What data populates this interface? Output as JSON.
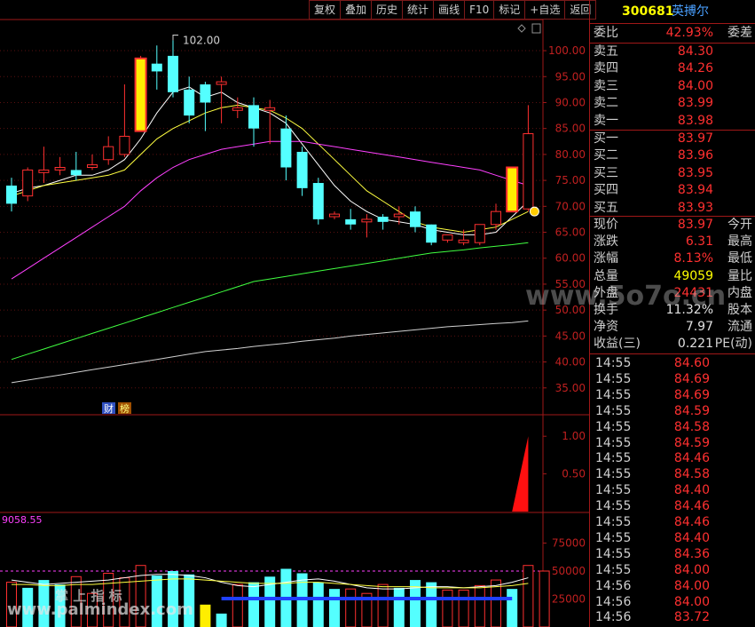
{
  "toolbar": [
    "复权",
    "叠加",
    "历史",
    "统计",
    "画线",
    "F10",
    "标记",
    "+自选",
    "返回"
  ],
  "stock": {
    "code": "300681",
    "name": "英搏尔"
  },
  "quote": {
    "webi_label": "委比",
    "webi_value": "42.93%",
    "webi_right": "委差",
    "sells": [
      {
        "label": "卖五",
        "price": "84.30"
      },
      {
        "label": "卖四",
        "price": "84.26"
      },
      {
        "label": "卖三",
        "price": "84.00"
      },
      {
        "label": "卖二",
        "price": "83.99"
      },
      {
        "label": "卖一",
        "price": "83.98"
      }
    ],
    "buys": [
      {
        "label": "买一",
        "price": "83.97"
      },
      {
        "label": "买二",
        "price": "83.96"
      },
      {
        "label": "买三",
        "price": "83.95"
      },
      {
        "label": "买四",
        "price": "83.94"
      },
      {
        "label": "买五",
        "price": "83.93"
      }
    ],
    "stats": [
      {
        "label": "现价",
        "value": "83.97",
        "right": "今开",
        "color": "red"
      },
      {
        "label": "涨跌",
        "value": "6.31",
        "right": "最高",
        "color": "red"
      },
      {
        "label": "涨幅",
        "value": "8.13%",
        "right": "最低",
        "color": "red"
      },
      {
        "label": "总量",
        "value": "49059",
        "right": "量比",
        "color": "yel"
      },
      {
        "label": "外盘",
        "value": "24431",
        "right": "内盘",
        "color": "red"
      },
      {
        "label": "换手",
        "value": "11.32%",
        "right": "股本",
        "color": "wht"
      },
      {
        "label": "净资",
        "value": "7.97",
        "right": "流通",
        "color": "wht"
      },
      {
        "label": "收益(三)",
        "value": "0.221",
        "right": "PE(动)",
        "color": "wht"
      }
    ],
    "ticks": [
      {
        "time": "14:55",
        "price": "84.60"
      },
      {
        "time": "14:55",
        "price": "84.69"
      },
      {
        "time": "14:55",
        "price": "84.69"
      },
      {
        "time": "14:55",
        "price": "84.59"
      },
      {
        "time": "14:55",
        "price": "84.58"
      },
      {
        "time": "14:55",
        "price": "84.59"
      },
      {
        "time": "14:55",
        "price": "84.46"
      },
      {
        "time": "14:55",
        "price": "84.58"
      },
      {
        "time": "14:55",
        "price": "84.40"
      },
      {
        "time": "14:55",
        "price": "84.46"
      },
      {
        "time": "14:55",
        "price": "84.46"
      },
      {
        "time": "14:55",
        "price": "84.40"
      },
      {
        "time": "14:55",
        "price": "84.36"
      },
      {
        "time": "14:55",
        "price": "84.00"
      },
      {
        "time": "14:56",
        "price": "84.00"
      },
      {
        "time": "14:56",
        "price": "84.00"
      },
      {
        "time": "14:56",
        "price": "83.72"
      }
    ]
  },
  "watermark_1": "www.5o7o.cn",
  "watermark_2": "掌 上 指 标",
  "watermark_3": "www.palmindex.com",
  "badges": [
    "财",
    "榜"
  ],
  "chart_data": [
    {
      "type": "candlestick",
      "ylim": [
        30,
        106
      ],
      "yticks": [
        "100.00",
        "95.00",
        "90.00",
        "85.00",
        "80.00",
        "75.00",
        "70.00",
        "65.00",
        "60.00",
        "55.00",
        "50.00",
        "45.00",
        "40.00",
        "35.00"
      ],
      "annotation": "102.00",
      "candles": [
        {
          "o": 74,
          "c": 70.5,
          "h": 75.5,
          "l": 69
        },
        {
          "o": 72,
          "c": 77,
          "h": 77.5,
          "l": 71
        },
        {
          "o": 76.5,
          "c": 77,
          "h": 81.5,
          "l": 74.5
        },
        {
          "o": 77,
          "c": 77.5,
          "h": 79.5,
          "l": 76
        },
        {
          "o": 77,
          "c": 76,
          "h": 80.5,
          "l": 75
        },
        {
          "o": 77.5,
          "c": 78,
          "h": 80,
          "l": 77
        },
        {
          "o": 79,
          "c": 81.5,
          "h": 83.5,
          "l": 78
        },
        {
          "o": 80,
          "c": 83.5,
          "h": 93.5,
          "l": 79.5
        },
        {
          "o": 84.5,
          "c": 98.5,
          "h": 99,
          "l": 84.5
        },
        {
          "o": 97.5,
          "c": 96,
          "h": 101,
          "l": 92.5
        },
        {
          "o": 99,
          "c": 92,
          "h": 102,
          "l": 91
        },
        {
          "o": 92.5,
          "c": 87.5,
          "h": 95,
          "l": 86
        },
        {
          "o": 93.5,
          "c": 90,
          "h": 94,
          "l": 84.5
        },
        {
          "o": 93.5,
          "c": 94,
          "h": 95,
          "l": 86
        },
        {
          "o": 88.5,
          "c": 89,
          "h": 91,
          "l": 87
        },
        {
          "o": 89.5,
          "c": 85,
          "h": 91,
          "l": 81.5
        },
        {
          "o": 88.5,
          "c": 89,
          "h": 90.5,
          "l": 82
        },
        {
          "o": 85,
          "c": 77.5,
          "h": 87.5,
          "l": 75
        },
        {
          "o": 80.5,
          "c": 73.5,
          "h": 81.5,
          "l": 72
        },
        {
          "o": 74.5,
          "c": 67.5,
          "h": 75.5,
          "l": 66.5
        },
        {
          "o": 68,
          "c": 68.5,
          "h": 69,
          "l": 67.5
        },
        {
          "o": 67.5,
          "c": 66.5,
          "h": 69.5,
          "l": 65.5
        },
        {
          "o": 67,
          "c": 67.5,
          "h": 68.5,
          "l": 64
        },
        {
          "o": 68,
          "c": 67,
          "h": 68.5,
          "l": 65.5
        },
        {
          "o": 68,
          "c": 68.5,
          "h": 70,
          "l": 66.5
        },
        {
          "o": 69,
          "c": 66,
          "h": 70,
          "l": 65
        },
        {
          "o": 66.5,
          "c": 63,
          "h": 66.5,
          "l": 62.5
        },
        {
          "o": 63.5,
          "c": 64.5,
          "h": 64.5,
          "l": 63
        },
        {
          "o": 63,
          "c": 63.5,
          "h": 65.5,
          "l": 62.5
        },
        {
          "o": 63,
          "c": 66.5,
          "h": 66.5,
          "l": 62.5
        },
        {
          "o": 66.5,
          "c": 69,
          "h": 70.5,
          "l": 65.5
        },
        {
          "o": 69,
          "c": 77.5,
          "h": 77.5,
          "l": 69
        },
        {
          "o": 69.5,
          "c": 84,
          "h": 89.5,
          "l": 69
        }
      ],
      "big_up": [
        8,
        31
      ],
      "ma": [
        {
          "color": "#ffffff",
          "values": [
            72.5,
            73.5,
            74,
            75,
            76,
            76,
            77,
            79,
            83,
            88,
            92,
            93,
            91,
            92,
            90,
            89,
            88,
            86,
            82,
            78,
            74,
            71,
            69,
            67.5,
            67,
            66.5,
            65.5,
            65,
            64.5,
            64.5,
            65,
            68,
            71
          ]
        },
        {
          "color": "#ffff40",
          "values": [
            72,
            73,
            74,
            74.5,
            75,
            75.5,
            76,
            77,
            80,
            83,
            85,
            86.5,
            88,
            89,
            89.5,
            89,
            88.5,
            87,
            85,
            82,
            79,
            76,
            73,
            71,
            69,
            67,
            66,
            65.5,
            65,
            65.5,
            66,
            67.5,
            69
          ]
        },
        {
          "color": "#ff40ff",
          "values": [
            56,
            58,
            60,
            62,
            64,
            66,
            68,
            70,
            73,
            75.5,
            77.5,
            79,
            80,
            81,
            81.5,
            82,
            82.5,
            82.5,
            82.5,
            82,
            81.5,
            81,
            80.5,
            80,
            79.5,
            79,
            78.5,
            78,
            77.5,
            77,
            76,
            75,
            74
          ]
        },
        {
          "color": "#40ff40",
          "values": [
            40.5,
            41.5,
            42.5,
            43.5,
            44.5,
            45.5,
            46.5,
            47.5,
            48.5,
            49.5,
            50.5,
            51.5,
            52.5,
            53.5,
            54.5,
            55.5,
            56,
            56.5,
            57,
            57.5,
            58,
            58.5,
            59,
            59.5,
            60,
            60.5,
            61,
            61.3,
            61.6,
            62,
            62.3,
            62.6,
            63
          ]
        },
        {
          "color": "#d0d0d0",
          "values": [
            36,
            36.5,
            37,
            37.5,
            38,
            38.5,
            39,
            39.5,
            40,
            40.5,
            41,
            41.5,
            42,
            42.3,
            42.6,
            43,
            43.3,
            43.6,
            44,
            44.3,
            44.6,
            45,
            45.3,
            45.6,
            45.9,
            46.2,
            46.5,
            46.8,
            47,
            47.2,
            47.4,
            47.6,
            47.9
          ]
        }
      ]
    },
    {
      "type": "area",
      "ylim": [
        0,
        1.25
      ],
      "yticks": [
        "1.00",
        "0.50"
      ],
      "values": [
        0,
        1.0
      ]
    },
    {
      "type": "bar",
      "title": "9058.55",
      "ylim": [
        0,
        100000
      ],
      "yticks": [
        "75000",
        "50000",
        "25000"
      ],
      "values": [
        40000,
        35000,
        42000,
        38000,
        45000,
        30000,
        48000,
        44000,
        55000,
        46000,
        50000,
        47000,
        20000,
        12000,
        38000,
        40000,
        45000,
        52000,
        48000,
        40000,
        34000,
        34000,
        30000,
        38000,
        35000,
        42000,
        40000,
        33000,
        33000,
        37000,
        42000,
        34000,
        55000,
        50000
      ],
      "up": [
        true,
        false,
        false,
        false,
        true,
        true,
        true,
        true,
        true,
        false,
        false,
        false,
        true,
        false,
        true,
        false,
        false,
        false,
        false,
        false,
        false,
        true,
        true,
        true,
        false,
        false,
        false,
        true,
        true,
        true,
        true,
        false,
        true,
        true
      ]
    }
  ]
}
